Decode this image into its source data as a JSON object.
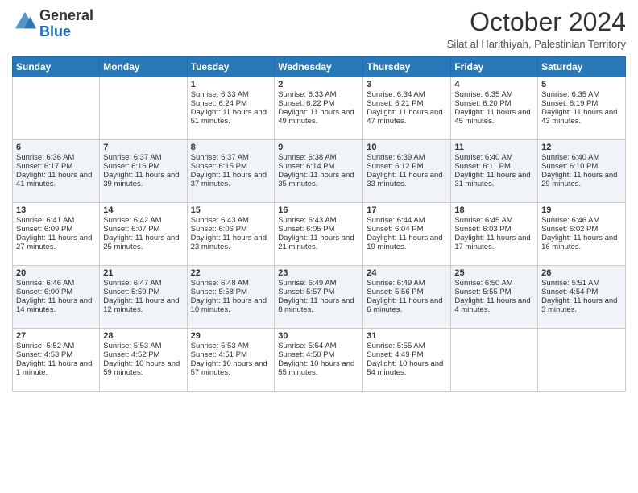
{
  "header": {
    "logo_line1": "General",
    "logo_line2": "Blue",
    "month_title": "October 2024",
    "location": "Silat al Harithiyah, Palestinian Territory"
  },
  "days_of_week": [
    "Sunday",
    "Monday",
    "Tuesday",
    "Wednesday",
    "Thursday",
    "Friday",
    "Saturday"
  ],
  "weeks": [
    [
      {
        "day": "",
        "sunrise": "",
        "sunset": "",
        "daylight": ""
      },
      {
        "day": "",
        "sunrise": "",
        "sunset": "",
        "daylight": ""
      },
      {
        "day": "1",
        "sunrise": "Sunrise: 6:33 AM",
        "sunset": "Sunset: 6:24 PM",
        "daylight": "Daylight: 11 hours and 51 minutes."
      },
      {
        "day": "2",
        "sunrise": "Sunrise: 6:33 AM",
        "sunset": "Sunset: 6:22 PM",
        "daylight": "Daylight: 11 hours and 49 minutes."
      },
      {
        "day": "3",
        "sunrise": "Sunrise: 6:34 AM",
        "sunset": "Sunset: 6:21 PM",
        "daylight": "Daylight: 11 hours and 47 minutes."
      },
      {
        "day": "4",
        "sunrise": "Sunrise: 6:35 AM",
        "sunset": "Sunset: 6:20 PM",
        "daylight": "Daylight: 11 hours and 45 minutes."
      },
      {
        "day": "5",
        "sunrise": "Sunrise: 6:35 AM",
        "sunset": "Sunset: 6:19 PM",
        "daylight": "Daylight: 11 hours and 43 minutes."
      }
    ],
    [
      {
        "day": "6",
        "sunrise": "Sunrise: 6:36 AM",
        "sunset": "Sunset: 6:17 PM",
        "daylight": "Daylight: 11 hours and 41 minutes."
      },
      {
        "day": "7",
        "sunrise": "Sunrise: 6:37 AM",
        "sunset": "Sunset: 6:16 PM",
        "daylight": "Daylight: 11 hours and 39 minutes."
      },
      {
        "day": "8",
        "sunrise": "Sunrise: 6:37 AM",
        "sunset": "Sunset: 6:15 PM",
        "daylight": "Daylight: 11 hours and 37 minutes."
      },
      {
        "day": "9",
        "sunrise": "Sunrise: 6:38 AM",
        "sunset": "Sunset: 6:14 PM",
        "daylight": "Daylight: 11 hours and 35 minutes."
      },
      {
        "day": "10",
        "sunrise": "Sunrise: 6:39 AM",
        "sunset": "Sunset: 6:12 PM",
        "daylight": "Daylight: 11 hours and 33 minutes."
      },
      {
        "day": "11",
        "sunrise": "Sunrise: 6:40 AM",
        "sunset": "Sunset: 6:11 PM",
        "daylight": "Daylight: 11 hours and 31 minutes."
      },
      {
        "day": "12",
        "sunrise": "Sunrise: 6:40 AM",
        "sunset": "Sunset: 6:10 PM",
        "daylight": "Daylight: 11 hours and 29 minutes."
      }
    ],
    [
      {
        "day": "13",
        "sunrise": "Sunrise: 6:41 AM",
        "sunset": "Sunset: 6:09 PM",
        "daylight": "Daylight: 11 hours and 27 minutes."
      },
      {
        "day": "14",
        "sunrise": "Sunrise: 6:42 AM",
        "sunset": "Sunset: 6:07 PM",
        "daylight": "Daylight: 11 hours and 25 minutes."
      },
      {
        "day": "15",
        "sunrise": "Sunrise: 6:43 AM",
        "sunset": "Sunset: 6:06 PM",
        "daylight": "Daylight: 11 hours and 23 minutes."
      },
      {
        "day": "16",
        "sunrise": "Sunrise: 6:43 AM",
        "sunset": "Sunset: 6:05 PM",
        "daylight": "Daylight: 11 hours and 21 minutes."
      },
      {
        "day": "17",
        "sunrise": "Sunrise: 6:44 AM",
        "sunset": "Sunset: 6:04 PM",
        "daylight": "Daylight: 11 hours and 19 minutes."
      },
      {
        "day": "18",
        "sunrise": "Sunrise: 6:45 AM",
        "sunset": "Sunset: 6:03 PM",
        "daylight": "Daylight: 11 hours and 17 minutes."
      },
      {
        "day": "19",
        "sunrise": "Sunrise: 6:46 AM",
        "sunset": "Sunset: 6:02 PM",
        "daylight": "Daylight: 11 hours and 16 minutes."
      }
    ],
    [
      {
        "day": "20",
        "sunrise": "Sunrise: 6:46 AM",
        "sunset": "Sunset: 6:00 PM",
        "daylight": "Daylight: 11 hours and 14 minutes."
      },
      {
        "day": "21",
        "sunrise": "Sunrise: 6:47 AM",
        "sunset": "Sunset: 5:59 PM",
        "daylight": "Daylight: 11 hours and 12 minutes."
      },
      {
        "day": "22",
        "sunrise": "Sunrise: 6:48 AM",
        "sunset": "Sunset: 5:58 PM",
        "daylight": "Daylight: 11 hours and 10 minutes."
      },
      {
        "day": "23",
        "sunrise": "Sunrise: 6:49 AM",
        "sunset": "Sunset: 5:57 PM",
        "daylight": "Daylight: 11 hours and 8 minutes."
      },
      {
        "day": "24",
        "sunrise": "Sunrise: 6:49 AM",
        "sunset": "Sunset: 5:56 PM",
        "daylight": "Daylight: 11 hours and 6 minutes."
      },
      {
        "day": "25",
        "sunrise": "Sunrise: 6:50 AM",
        "sunset": "Sunset: 5:55 PM",
        "daylight": "Daylight: 11 hours and 4 minutes."
      },
      {
        "day": "26",
        "sunrise": "Sunrise: 5:51 AM",
        "sunset": "Sunset: 4:54 PM",
        "daylight": "Daylight: 11 hours and 3 minutes."
      }
    ],
    [
      {
        "day": "27",
        "sunrise": "Sunrise: 5:52 AM",
        "sunset": "Sunset: 4:53 PM",
        "daylight": "Daylight: 11 hours and 1 minute."
      },
      {
        "day": "28",
        "sunrise": "Sunrise: 5:53 AM",
        "sunset": "Sunset: 4:52 PM",
        "daylight": "Daylight: 10 hours and 59 minutes."
      },
      {
        "day": "29",
        "sunrise": "Sunrise: 5:53 AM",
        "sunset": "Sunset: 4:51 PM",
        "daylight": "Daylight: 10 hours and 57 minutes."
      },
      {
        "day": "30",
        "sunrise": "Sunrise: 5:54 AM",
        "sunset": "Sunset: 4:50 PM",
        "daylight": "Daylight: 10 hours and 55 minutes."
      },
      {
        "day": "31",
        "sunrise": "Sunrise: 5:55 AM",
        "sunset": "Sunset: 4:49 PM",
        "daylight": "Daylight: 10 hours and 54 minutes."
      },
      {
        "day": "",
        "sunrise": "",
        "sunset": "",
        "daylight": ""
      },
      {
        "day": "",
        "sunrise": "",
        "sunset": "",
        "daylight": ""
      }
    ]
  ]
}
